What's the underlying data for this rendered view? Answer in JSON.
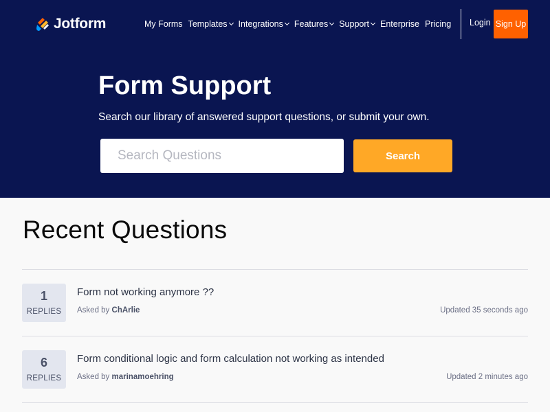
{
  "header": {
    "logo_text": "Jotform",
    "nav": [
      {
        "label": "My Forms",
        "dropdown": false
      },
      {
        "label": "Templates",
        "dropdown": true
      },
      {
        "label": "Integrations",
        "dropdown": true
      },
      {
        "label": "Features",
        "dropdown": true
      },
      {
        "label": "Support",
        "dropdown": true
      },
      {
        "label": "Enterprise",
        "dropdown": false
      },
      {
        "label": "Pricing",
        "dropdown": false
      }
    ],
    "login_label": "Login",
    "signup_label": "Sign Up"
  },
  "hero": {
    "title": "Form Support",
    "subtitle": "Search our library of answered support questions, or submit your own.",
    "search_placeholder": "Search Questions",
    "search_button": "Search"
  },
  "recent": {
    "title": "Recent Questions",
    "questions": [
      {
        "replies": "1",
        "replies_label": "REPLIES",
        "title": "Form not working anymore ??",
        "asked_prefix": "Asked by",
        "user": "ChArlie",
        "updated": "Updated 35 seconds ago"
      },
      {
        "replies": "6",
        "replies_label": "REPLIES",
        "title": "Form conditional logic and form calculation not working as intended",
        "asked_prefix": "Asked by",
        "user": "marinamoehring",
        "updated": "Updated 2 minutes ago"
      }
    ]
  },
  "colors": {
    "navy": "#0a1551",
    "orange": "#ff6100",
    "amber": "#ffa826",
    "background": "#f9f9f9"
  }
}
